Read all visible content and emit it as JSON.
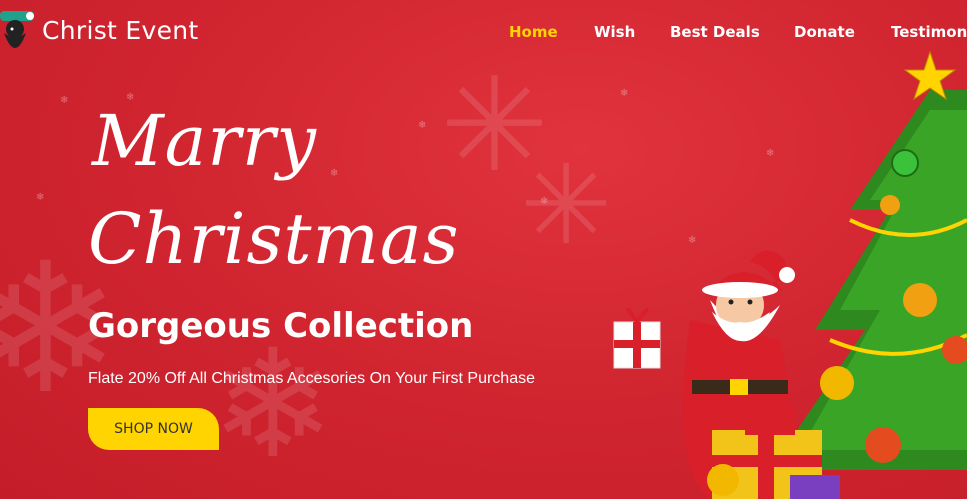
{
  "brand": {
    "name": "Christ Event",
    "logo_icon": "santa-logo-icon"
  },
  "nav": {
    "items": [
      {
        "label": "Home",
        "active": true
      },
      {
        "label": "Wish",
        "active": false
      },
      {
        "label": "Best Deals",
        "active": false
      },
      {
        "label": "Donate",
        "active": false
      },
      {
        "label": "Testimon",
        "active": false
      }
    ]
  },
  "hero": {
    "script_line1": "Marry",
    "script_line2": "Christmas",
    "headline": "Gorgeous Collection",
    "offer": "Flate 20% Off All Christmas Accesories On Your First Purchase",
    "cta_label": "SHOP NOW"
  },
  "colors": {
    "background": "#d3232f",
    "accent": "#ffd400",
    "text": "#ffffff"
  },
  "decor_icons": [
    "snowflake-icon",
    "santa-illustration",
    "christmas-tree-illustration",
    "gift-icon",
    "star-icon"
  ]
}
